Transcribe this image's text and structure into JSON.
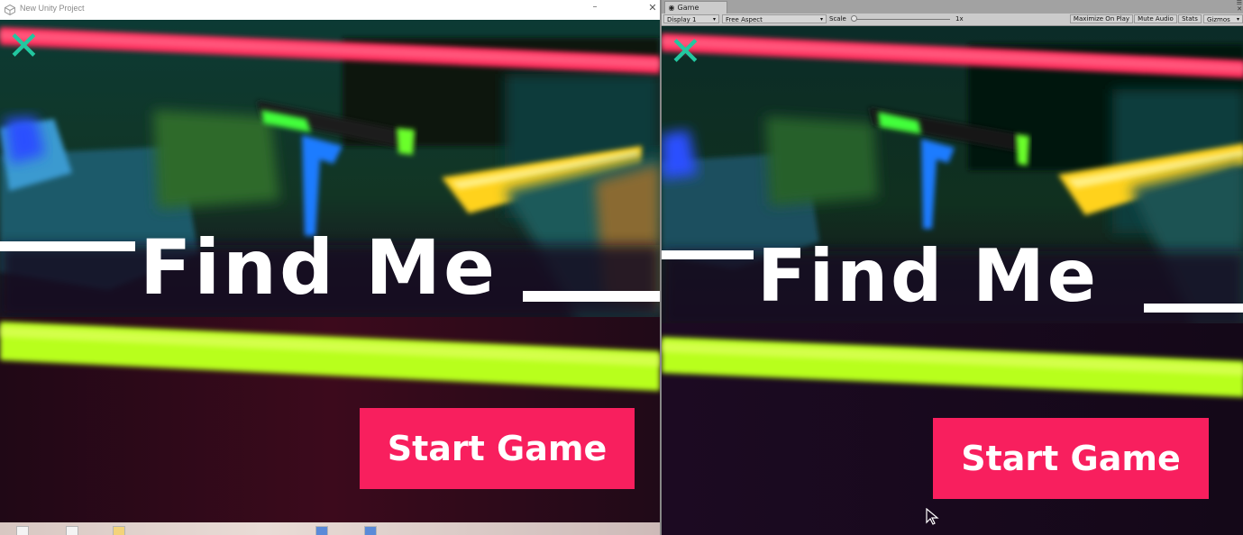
{
  "left_window": {
    "title": "New Unity Project",
    "game": {
      "close_icon": "✕",
      "title": "Find Me",
      "start_button": "Start Game"
    }
  },
  "right_window": {
    "tab_label": "Game",
    "toolbar": {
      "display": "Display 1",
      "aspect": "Free Aspect",
      "scale_label": "Scale",
      "scale_value": "1x",
      "maximize_on_play": "Maximize On Play",
      "mute_audio": "Mute Audio",
      "stats": "Stats",
      "gizmos": "Gizmos"
    },
    "game": {
      "close_icon": "✕",
      "title": "Find Me",
      "start_button": "Start Game"
    }
  },
  "colors": {
    "accent_button": "#f81f5e",
    "close_icon": "#22c7a0",
    "neon_red": "#ff2a5a",
    "neon_green": "#b8ff1a",
    "neon_yellow": "#ffd21a",
    "neon_blue": "#1e6bff"
  }
}
